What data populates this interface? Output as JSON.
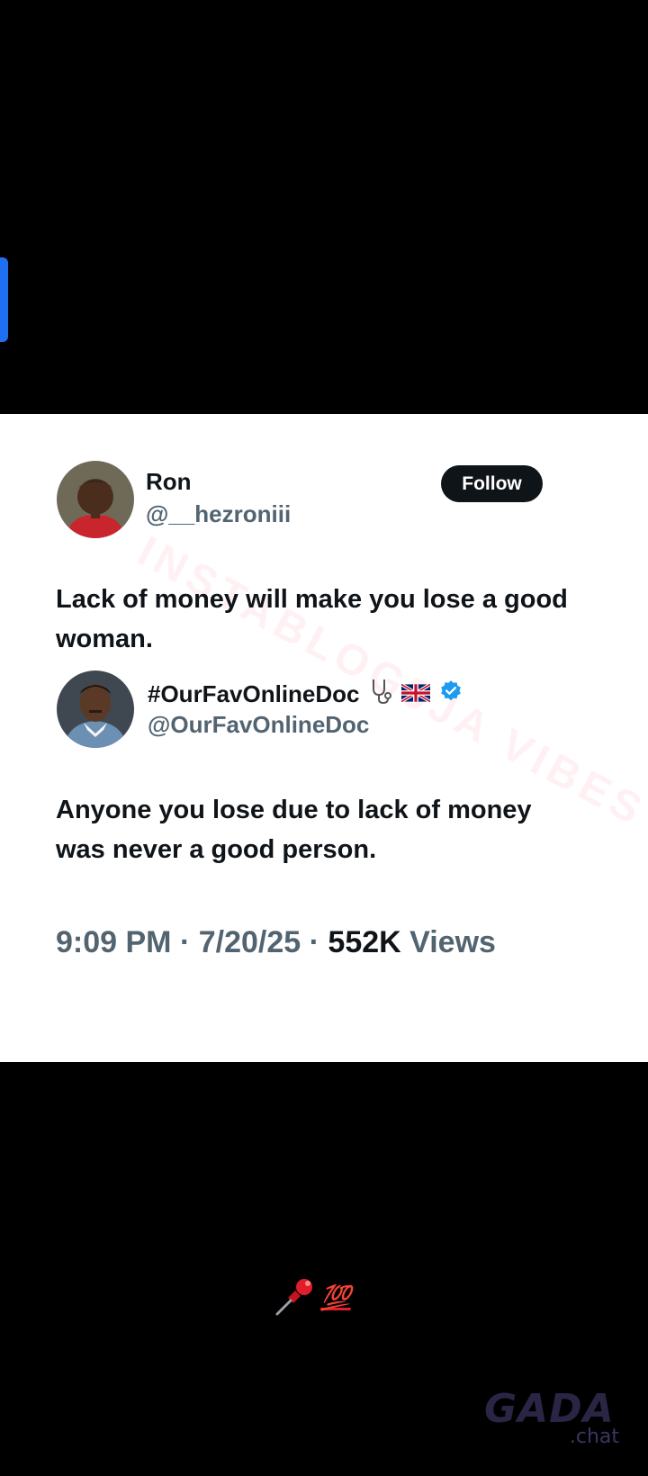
{
  "colors": {
    "background": "#000000",
    "card": "#ffffff",
    "primary_text": "#0f1419",
    "secondary_text": "#536471",
    "verified": "#1d9bf0",
    "accent_tab": "#1e6ff2"
  },
  "tweet": {
    "author": {
      "name": "Ron",
      "handle": "@__hezroniii"
    },
    "follow_label": "Follow",
    "text": "Lack of money will make you lose a good woman."
  },
  "quoted": {
    "author": {
      "name": "#OurFavOnlineDoc",
      "handle": "@OurFavOnlineDoc",
      "name_icons": [
        "stethoscope-icon",
        "uk-flag-icon",
        "verified-badge-icon"
      ]
    },
    "text": "Anyone you lose due to lack of money was never a good person."
  },
  "meta": {
    "time": "9:09 PM",
    "date": "7/20/25",
    "views_count": "552K",
    "views_label": "Views",
    "separator": "·"
  },
  "watermark_text": "INSTABLOG9JA VIBES",
  "caption": {
    "icon": "pushpin-icon",
    "emoji": "💯"
  },
  "logo": {
    "main": "GADA",
    "sub": ".chat"
  }
}
